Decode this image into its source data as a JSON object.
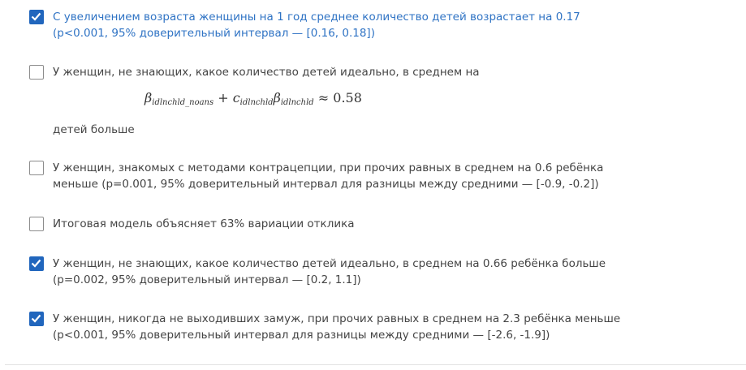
{
  "options": [
    {
      "label": "С увеличением возраста женщины на 1 год среднее количество детей возрастает на 0.17 (p<0.001, 95% доверительный интервал — [0.16, 0.18])",
      "checked": true
    },
    {
      "label": "У женщин, не знающих, какое количество детей идеально, в среднем на",
      "checked": false
    },
    {
      "label": "У женщин, знакомых с методами контрацепции, при прочих равных в среднем на 0.6 ребёнка меньше (p=0.001, 95% доверительный интервал для разницы между средними — [-0.9, -0.2])",
      "checked": false
    },
    {
      "label": "Итоговая модель объясняет 63% вариации отклика",
      "checked": false
    },
    {
      "label": "У женщин, не знающих, какое количество детей идеально, в среднем на 0.66 ребёнка больше (p=0.002, 95% доверительный интервал — [0.2, 1.1])",
      "checked": true
    },
    {
      "label": "У женщин, никогда не выходивших замуж, при прочих равных в среднем на 2.3 ребёнка меньше (p<0.001, 95% доверительный интервал для разницы между средними — [-2.6, -1.9])",
      "checked": true
    }
  ],
  "formula": {
    "beta1": "β",
    "sub1": "idlnchld_noans",
    "plus": " + ",
    "c": "c",
    "sub2": "idlnchld",
    "beta2": "β",
    "sub3": "idlnchld",
    "approx": " ≈ 0.58"
  },
  "after_formula": "детей больше",
  "colors": {
    "accent": "#2166bd",
    "selected_text": "#2f73c4"
  },
  "icons": {
    "checked": "checkmark-icon"
  }
}
